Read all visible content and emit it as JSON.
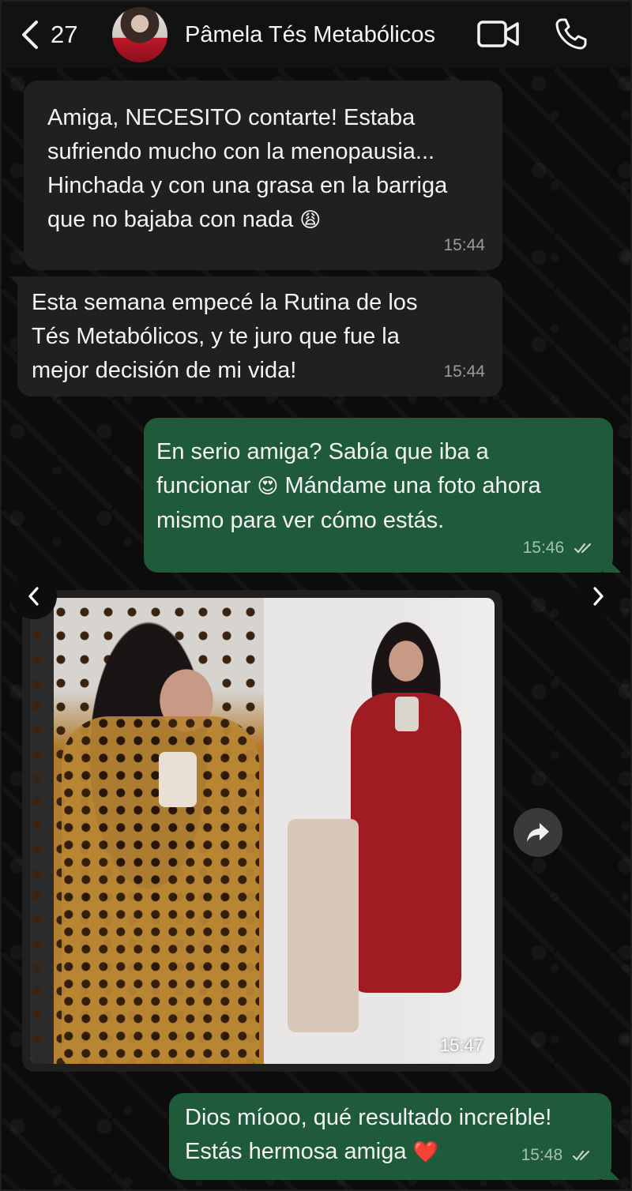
{
  "header": {
    "back_count": "27",
    "contact_name": "Pâmela Tés Metabólicos",
    "icons": {
      "back": "chevron-left-icon",
      "video": "video-camera-icon",
      "call": "phone-icon"
    }
  },
  "messages": [
    {
      "direction": "incoming",
      "lines": [
        "Amiga, NECESITO contarte! Estaba",
        "sufriendo mucho con la menopausia...",
        "Hinchada y con una grasa en la barriga",
        "que no bajaba con nada"
      ],
      "emoji": "😩",
      "time": "15:44"
    },
    {
      "direction": "incoming",
      "lines": [
        "Esta semana empecé la Rutina de los",
        "Tés Metabólicos, y te juro que fue la",
        "mejor decisión de mi vida!"
      ],
      "time": "15:44"
    },
    {
      "direction": "outgoing",
      "lines": [
        "En serio amiga? Sabía que iba a",
        "funcionar",
        "Mándame una foto ahora",
        "mismo para  ver cómo estás."
      ],
      "emoji": "😍",
      "time": "15:46",
      "status": "read"
    },
    {
      "direction": "incoming",
      "type": "photo",
      "time": "15:47"
    },
    {
      "direction": "outgoing",
      "lines": [
        "Dios míooo, qué resultado increíble!",
        "Estás hermosa amiga"
      ],
      "emoji": "❤️",
      "time": "15:48",
      "status": "read"
    }
  ],
  "colors": {
    "incoming_bubble": "#202020",
    "outgoing_bubble": "#1f5a3b",
    "background": "#0c0c0c",
    "header": "#121212"
  }
}
